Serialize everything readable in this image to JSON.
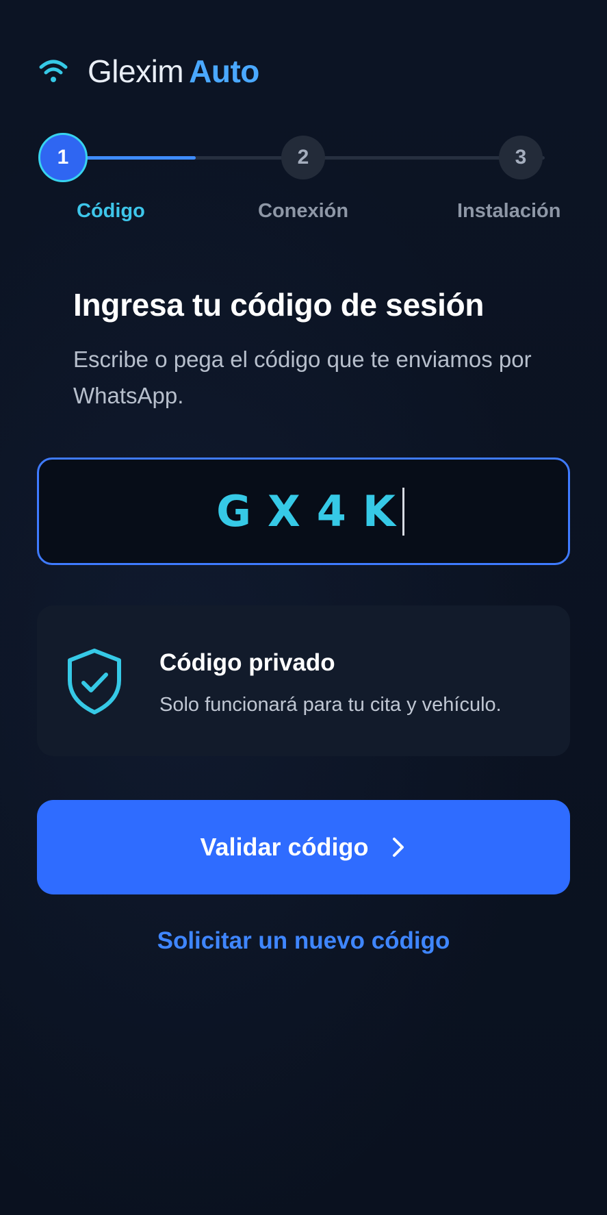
{
  "brand": {
    "name_light": "Glexim",
    "name_accent": "Auto"
  },
  "stepper": {
    "steps": [
      {
        "number": "1",
        "label": "Código",
        "state": "active"
      },
      {
        "number": "2",
        "label": "Conexión",
        "state": "pending"
      },
      {
        "number": "3",
        "label": "Instalación",
        "state": "pending"
      }
    ]
  },
  "form": {
    "title": "Ingresa tu código de sesión",
    "subtitle": "Escribe o pega el código que te enviamos por WhatsApp.",
    "code_value": "GX4K"
  },
  "info_card": {
    "title": "Código privado",
    "text": "Solo funcionará para tu cita y vehículo."
  },
  "actions": {
    "validate_label": "Validar código",
    "resend_label": "Solicitar un nuevo código"
  },
  "colors": {
    "background": "#0b1220",
    "accent_blue": "#2f6cff",
    "accent_cyan": "#36c9e6",
    "brand_accent": "#4aa8ff"
  },
  "icons": {
    "logo": "wifi-icon",
    "info": "shield-check-icon",
    "button": "chevron-right-icon"
  }
}
